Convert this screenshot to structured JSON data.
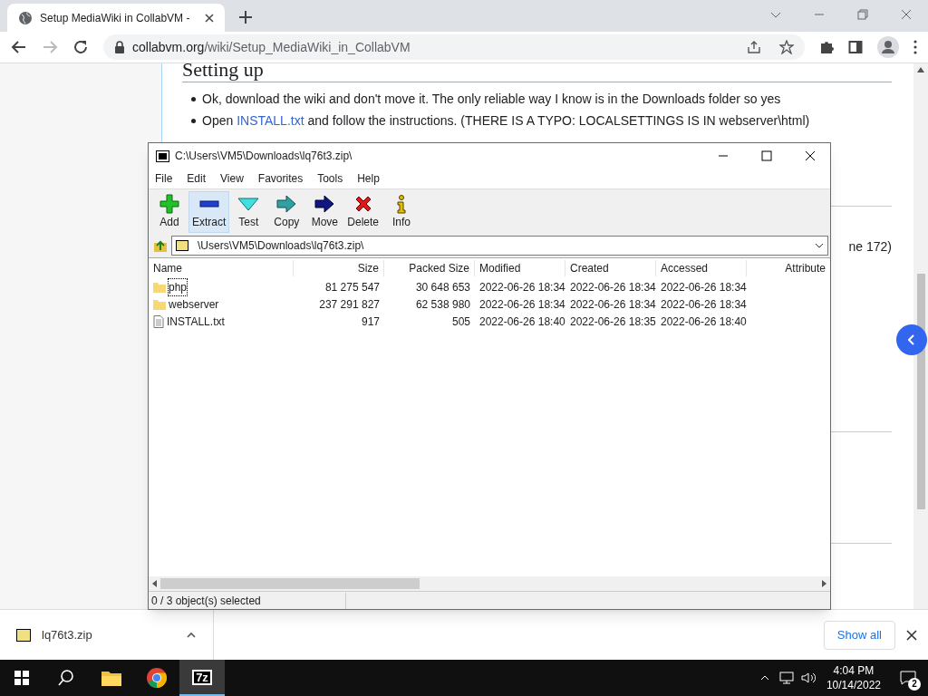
{
  "browser": {
    "tab_title": "Setup MediaWiki in CollabVM -",
    "url_host": "collabvm.org",
    "url_path": "/wiki/Setup_MediaWiki_in_CollabVM"
  },
  "article": {
    "heading": "Setting up",
    "bullets": [
      {
        "text": "Ok, download the wiki and don't move it. The only reliable way I know is in the Downloads folder so yes"
      },
      {
        "before": "Open ",
        "link": "INSTALL.txt",
        "after": " and follow the instructions. (THERE IS A TYPO: LOCALSETTINGS IS IN webserver\\html)"
      }
    ],
    "side_fragment": "ne 172)"
  },
  "archive_window": {
    "title": "C:\\Users\\VM5\\Downloads\\lq76t3.zip\\",
    "menu": [
      "File",
      "Edit",
      "View",
      "Favorites",
      "Tools",
      "Help"
    ],
    "toolbar": [
      {
        "kind": "add",
        "label": "Add",
        "selected": false
      },
      {
        "kind": "extract",
        "label": "Extract",
        "selected": true
      },
      {
        "kind": "test",
        "label": "Test",
        "selected": false
      },
      {
        "kind": "copy",
        "label": "Copy",
        "selected": false
      },
      {
        "kind": "move",
        "label": "Move",
        "selected": false
      },
      {
        "kind": "delete",
        "label": "Delete",
        "selected": false
      },
      {
        "kind": "info",
        "label": "Info",
        "selected": false
      }
    ],
    "path": "\\Users\\VM5\\Downloads\\lq76t3.zip\\",
    "columns": [
      "Name",
      "Size",
      "Packed Size",
      "Modified",
      "Created",
      "Accessed",
      "Attribute"
    ],
    "rows": [
      {
        "kind": "folder",
        "name": "php",
        "size": "81 275 547",
        "packed": "30 648 653",
        "modified": "2022-06-26 18:34",
        "created": "2022-06-26 18:34",
        "accessed": "2022-06-26 18:34",
        "focused": true
      },
      {
        "kind": "folder",
        "name": "webserver",
        "size": "237 291 827",
        "packed": "62 538 980",
        "modified": "2022-06-26 18:34",
        "created": "2022-06-26 18:34",
        "accessed": "2022-06-26 18:34",
        "focused": false
      },
      {
        "kind": "file",
        "name": "INSTALL.txt",
        "size": "917",
        "packed": "505",
        "modified": "2022-06-26 18:40",
        "created": "2022-06-26 18:35",
        "accessed": "2022-06-26 18:40",
        "focused": false
      }
    ],
    "status": "0 / 3 object(s) selected"
  },
  "download_bar": {
    "file": "lq76t3.zip",
    "show_all": "Show all"
  },
  "taskbar": {
    "time": "4:04 PM",
    "date": "10/14/2022",
    "notifications": "2",
    "apps": [
      {
        "kind": "search",
        "selected": false
      },
      {
        "kind": "explorer",
        "selected": false
      },
      {
        "kind": "chrome",
        "selected": false
      },
      {
        "kind": "sevenzip",
        "label": "7z",
        "selected": true
      }
    ]
  }
}
